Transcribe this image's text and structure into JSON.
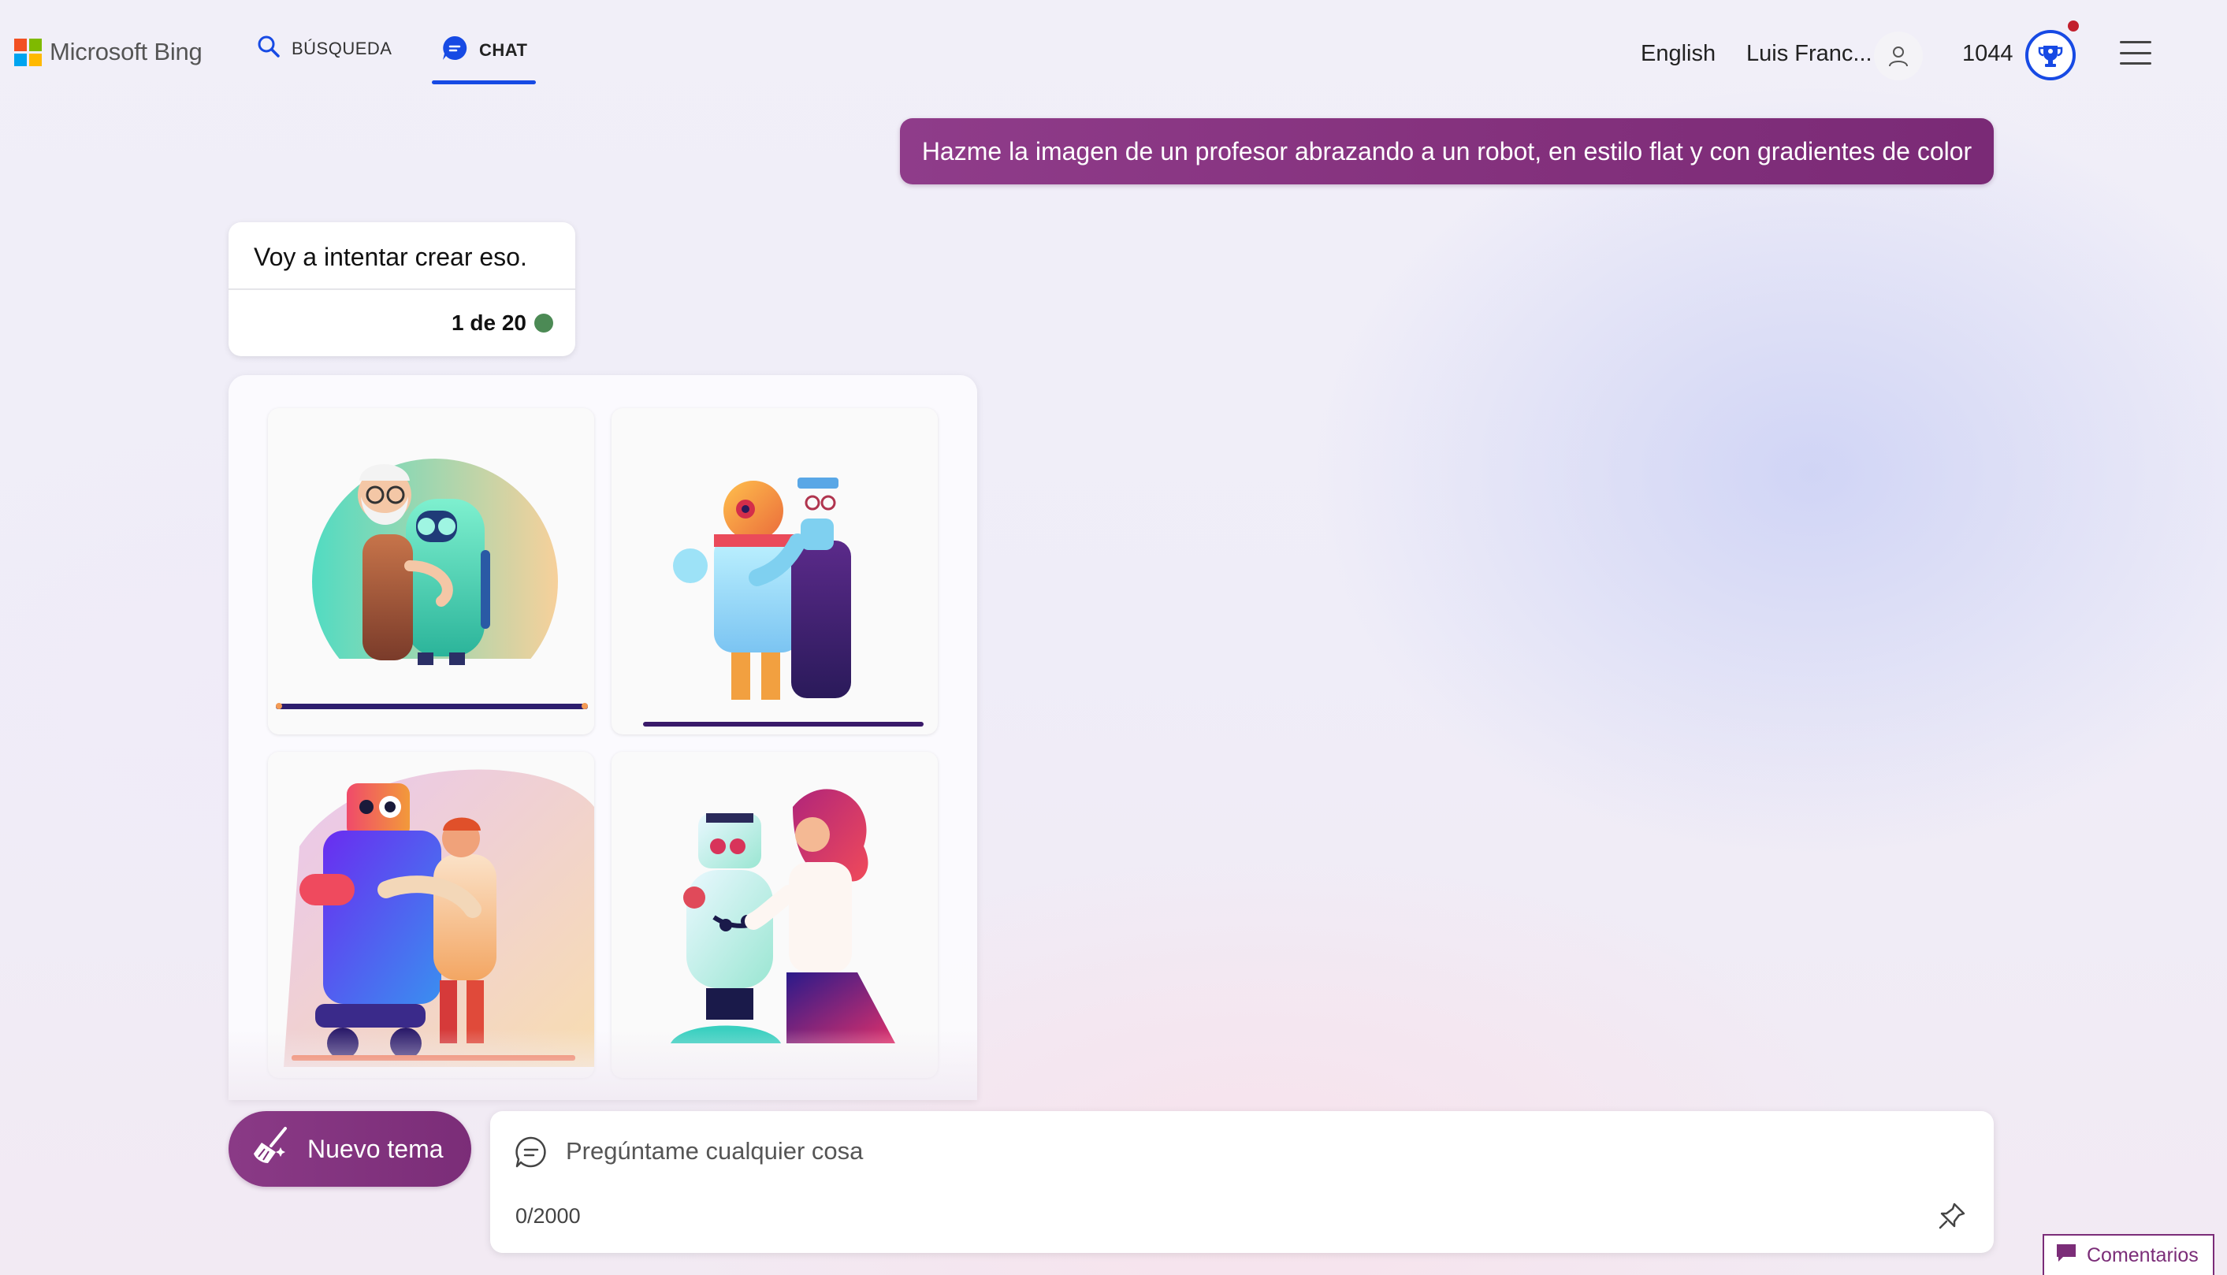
{
  "header": {
    "logo_text": "Microsoft Bing",
    "logo_colors": [
      "#f25022",
      "#7fba00",
      "#00a4ef",
      "#ffb900"
    ],
    "tabs": [
      {
        "label": "BÚSQUEDA",
        "icon": "search-icon",
        "active": false
      },
      {
        "label": "CHAT",
        "icon": "chat-bubble-icon",
        "active": true
      }
    ],
    "language": "English",
    "user_name": "Luis Franc...",
    "points": "1044",
    "accent_color": "#174ae4"
  },
  "conversation": {
    "user_message": "Hazme la imagen de un profesor abrazando a un robot, en estilo flat y con gradientes de color",
    "bot_reply": "Voy a intentar crear eso.",
    "turn_counter": "1 de 20",
    "generated_images": [
      {
        "description": "elderly-professor-hugging-teal-robot"
      },
      {
        "description": "orange-robot-with-professor"
      },
      {
        "description": "purple-blue-robot-hugging-man"
      },
      {
        "description": "white-robot-hugging-woman"
      }
    ]
  },
  "composer": {
    "new_topic_label": "Nuevo tema",
    "placeholder": "Pregúntame cualquier cosa",
    "char_count": "0/2000"
  },
  "feedback_label": "Comentarios",
  "colors": {
    "message_purple": "#85327e",
    "status_green": "#4c8a55",
    "notification_red": "#c21f2d"
  }
}
